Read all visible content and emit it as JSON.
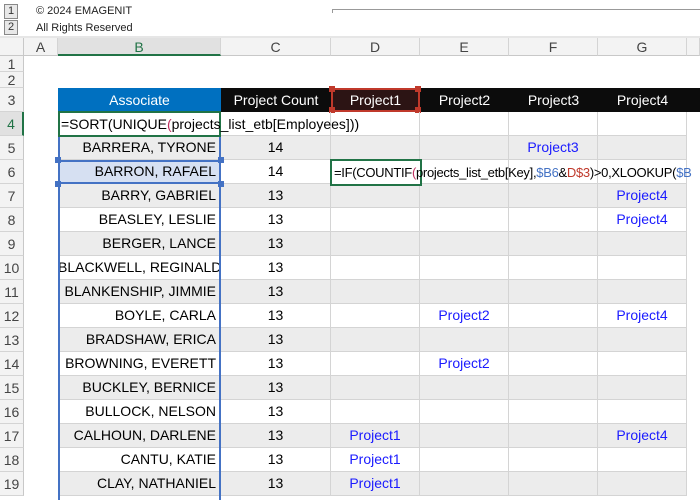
{
  "outline": {
    "levels": [
      "1",
      "2"
    ],
    "note1": "© 2024 EMAGENIT",
    "note2": "All Rights Reserved"
  },
  "columns": [
    "A",
    "B",
    "C",
    "D",
    "E",
    "F",
    "G"
  ],
  "rows": [
    "1",
    "2",
    "3",
    "4",
    "5",
    "6",
    "7",
    "8",
    "9",
    "10",
    "11",
    "12",
    "13",
    "14",
    "15",
    "16",
    "17",
    "18",
    "19"
  ],
  "table": {
    "headers": [
      "Associate",
      "Project Count",
      "Project1",
      "Project2",
      "Project3",
      "Project4"
    ],
    "colors": {
      "associate_header": "#0070c0",
      "header": "#0c0c0c",
      "selected_header": "#2c1414",
      "project_text": "#1a1aff"
    },
    "formula_b4": {
      "a": "=SORT(UNIQUE",
      "b": "(",
      "c": "projects_list_etb[Employees]",
      "d": "))"
    },
    "formula_d6": {
      "a": "=IF(COUNTIF",
      "b": "(",
      "c": "projects_list_etb[Key],",
      "d": "$B6",
      "e": "&",
      "f": "D$3",
      "g": ")>0,XLOOKUP(",
      "h": "$B"
    },
    "rows": [
      {
        "name": "BARRERA, TYRONE",
        "count": "14",
        "p": [
          "",
          "",
          "Project3",
          ""
        ]
      },
      {
        "name": "BARRON, RAFAEL",
        "count": "14",
        "p": [
          "",
          "",
          "",
          ""
        ]
      },
      {
        "name": "BARRY, GABRIEL",
        "count": "13",
        "p": [
          "",
          "",
          "",
          "Project4"
        ]
      },
      {
        "name": "BEASLEY, LESLIE",
        "count": "13",
        "p": [
          "",
          "",
          "",
          "Project4"
        ]
      },
      {
        "name": "BERGER, LANCE",
        "count": "13",
        "p": [
          "",
          "",
          "",
          ""
        ]
      },
      {
        "name": "BLACKWELL, REGINALD",
        "count": "13",
        "p": [
          "",
          "",
          "",
          ""
        ]
      },
      {
        "name": "BLANKENSHIP, JIMMIE",
        "count": "13",
        "p": [
          "",
          "",
          "",
          ""
        ]
      },
      {
        "name": "BOYLE, CARLA",
        "count": "13",
        "p": [
          "",
          "Project2",
          "",
          "Project4"
        ]
      },
      {
        "name": "BRADSHAW, ERICA",
        "count": "13",
        "p": [
          "",
          "",
          "",
          ""
        ]
      },
      {
        "name": "BROWNING, EVERETT",
        "count": "13",
        "p": [
          "",
          "Project2",
          "",
          ""
        ]
      },
      {
        "name": "BUCKLEY, BERNICE",
        "count": "13",
        "p": [
          "",
          "",
          "",
          ""
        ]
      },
      {
        "name": "BULLOCK, NELSON",
        "count": "13",
        "p": [
          "",
          "",
          "",
          ""
        ]
      },
      {
        "name": "CALHOUN, DARLENE",
        "count": "13",
        "p": [
          "Project1",
          "",
          "",
          "Project4"
        ]
      },
      {
        "name": "CANTU, KATIE",
        "count": "13",
        "p": [
          "Project1",
          "",
          "",
          ""
        ]
      },
      {
        "name": "CLAY, NATHANIEL",
        "count": "13",
        "p": [
          "Project1",
          "",
          "",
          ""
        ]
      }
    ]
  }
}
